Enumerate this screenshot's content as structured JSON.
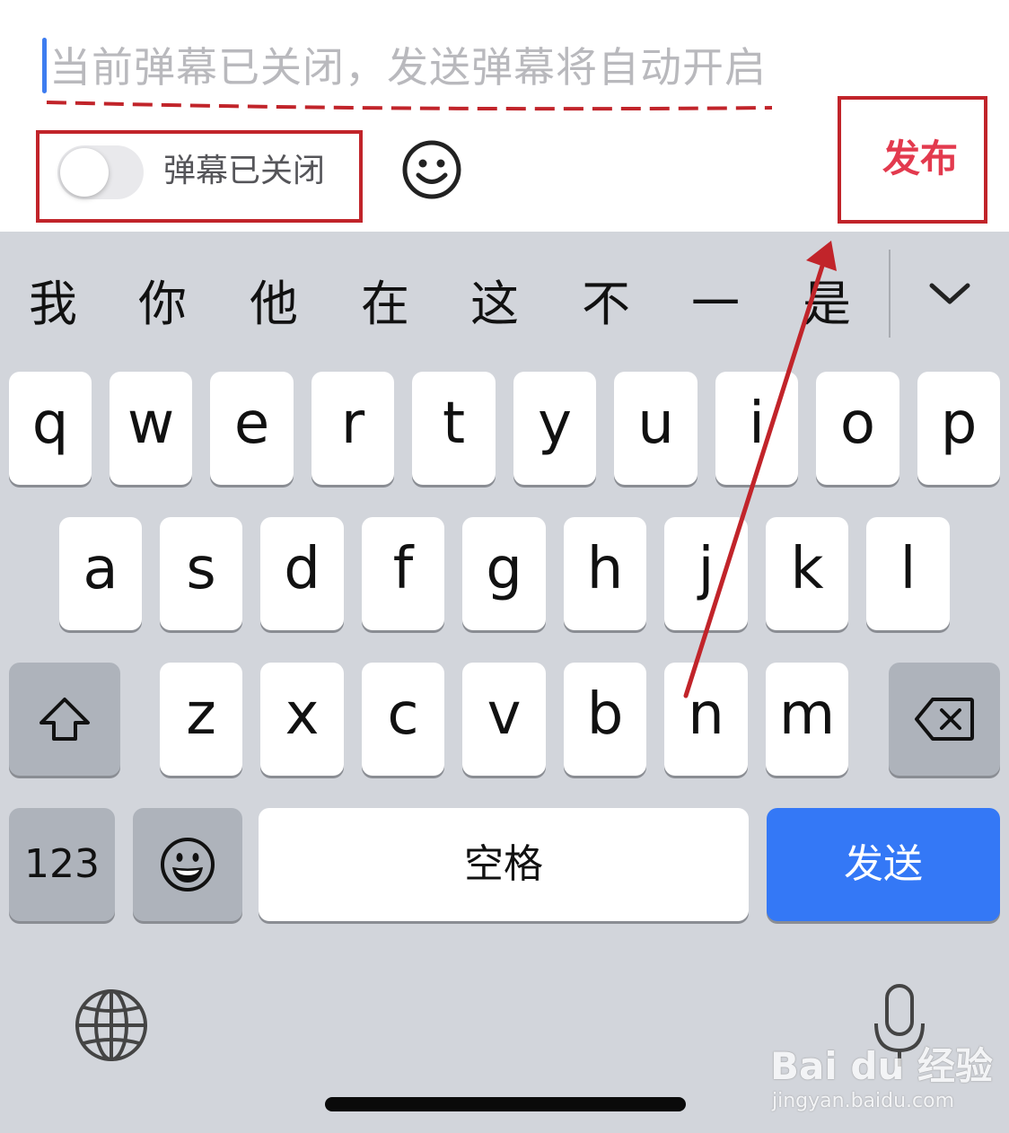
{
  "compose": {
    "placeholder": "当前弹幕已关闭，发送弹幕将自动开启",
    "danmaku_toggle_label": "弹幕已关闭",
    "danmaku_toggle_on": false,
    "publish_label": "发布",
    "emoji_icon": "smiley-icon"
  },
  "candidates": [
    "我",
    "你",
    "他",
    "在",
    "这",
    "不",
    "一",
    "是"
  ],
  "candidate_toggle_icon": "chevron-down-icon",
  "keys": {
    "row1": [
      "q",
      "w",
      "e",
      "r",
      "t",
      "y",
      "u",
      "i",
      "o",
      "p"
    ],
    "row2": [
      "a",
      "s",
      "d",
      "f",
      "g",
      "h",
      "j",
      "k",
      "l"
    ],
    "row3": [
      "z",
      "x",
      "c",
      "v",
      "b",
      "n",
      "m"
    ],
    "shift_icon": "shift-icon",
    "backspace_icon": "backspace-icon",
    "numbers_label": "123",
    "emoji_key_icon": "emoji-icon",
    "space_label": "空格",
    "send_label": "发送",
    "globe_icon": "globe-icon",
    "mic_icon": "microphone-icon"
  },
  "watermark": {
    "brand": "Bai du 经验",
    "url": "jingyan.baidu.com"
  },
  "colors": {
    "annotation": "#c1242a",
    "publish": "#e33a4e",
    "send_key": "#3478f6",
    "keyboard_bg": "#d2d5db",
    "caret": "#3d7cf0"
  }
}
